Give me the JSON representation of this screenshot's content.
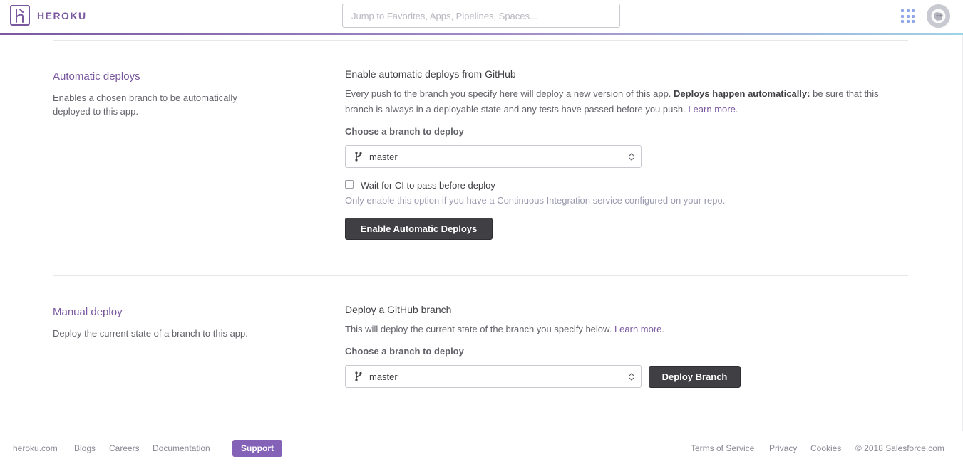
{
  "header": {
    "brand": "HEROKU",
    "search_placeholder": "Jump to Favorites, Apps, Pipelines, Spaces..."
  },
  "automatic": {
    "title": "Automatic deploys",
    "description": "Enables a chosen branch to be automatically deployed to this app.",
    "heading": "Enable automatic deploys from GitHub",
    "para_start": "Every push to the branch you specify here will deploy a new version of this app.",
    "para_bold": "Deploys happen automatically:",
    "para_end": "be sure that this branch is always in a deployable state and any tests have passed before you push.",
    "learn_more": "Learn more.",
    "branch_label": "Choose a branch to deploy",
    "branch_value": "master",
    "ci_label": "Wait for CI to pass before deploy",
    "ci_hint": "Only enable this option if you have a Continuous Integration service configured on your repo.",
    "button": "Enable Automatic Deploys"
  },
  "manual": {
    "title": "Manual deploy",
    "description": "Deploy the current state of a branch to this app.",
    "heading": "Deploy a GitHub branch",
    "para": "This will deploy the current state of the branch you specify below.",
    "learn_more": "Learn more.",
    "branch_label": "Choose a branch to deploy",
    "branch_value": "master",
    "button": "Deploy Branch"
  },
  "footer": {
    "links_left": [
      "heroku.com",
      "Blogs",
      "Careers",
      "Documentation"
    ],
    "support": "Support",
    "links_right": [
      "Terms of Service",
      "Privacy",
      "Cookies"
    ],
    "copyright": "© 2018 Salesforce.com"
  },
  "colors": {
    "brand_purple": "#79589f",
    "dark_button": "#3f3f44",
    "support_purple": "#8462b8"
  }
}
